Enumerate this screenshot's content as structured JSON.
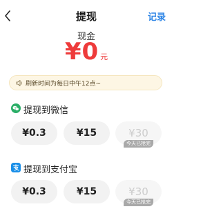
{
  "header": {
    "back_icon": "chevron-left-icon",
    "title": "提现",
    "record_label": "记录"
  },
  "balance": {
    "label": "现金",
    "amount": "¥0",
    "unit": "元",
    "color": "#ee3b3b"
  },
  "notice": {
    "icon": "speaker-icon",
    "text": "刷新时间为每日中午12点~"
  },
  "sections": [
    {
      "icon": "wechat-icon",
      "title": "提现到微信",
      "options": [
        {
          "label": "¥0.3",
          "disabled": false
        },
        {
          "label": "¥15",
          "disabled": false
        },
        {
          "label": "¥30",
          "disabled": true,
          "tag": "今天已抢完"
        }
      ]
    },
    {
      "icon": "alipay-icon",
      "title": "提现到支付宝",
      "options": [
        {
          "label": "¥0.3",
          "disabled": false
        },
        {
          "label": "¥15",
          "disabled": false
        },
        {
          "label": "¥30",
          "disabled": true,
          "tag": "今天已抢完"
        }
      ]
    }
  ],
  "colors": {
    "accent": "#2f86e6",
    "wechat": "#2aae67",
    "alipay": "#1a8fe8"
  }
}
